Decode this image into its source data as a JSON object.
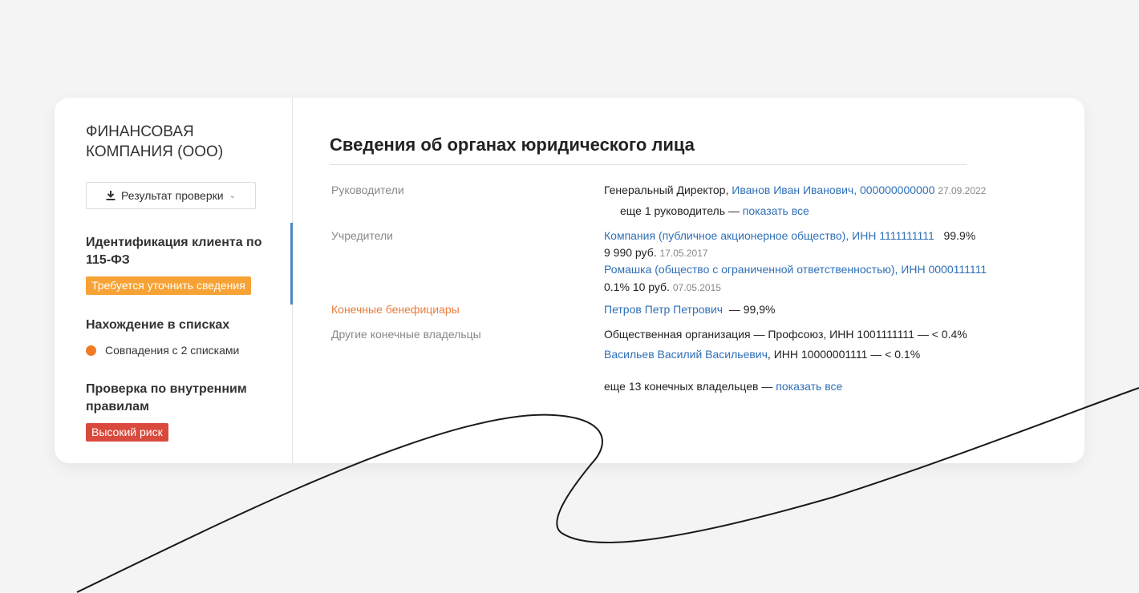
{
  "company": {
    "name": "ФИНАНСОВАЯ КОМПАНИЯ (ООО)"
  },
  "result_button": {
    "label": "Результат проверки"
  },
  "sidebar": {
    "identification": {
      "title": "Идентификация клиента по 115-ФЗ",
      "badge": "Требуется уточнить сведения"
    },
    "lists": {
      "title": "Нахождение в списках",
      "match": "Совпадения с 2 списками"
    },
    "internal": {
      "title": "Проверка по внутренним правилам",
      "badge": "Высокий риск"
    }
  },
  "main": {
    "title": "Сведения об органах юридического лица",
    "leaders": {
      "label": "Руководители",
      "position": "Генеральный Директор,",
      "person": "Иванов Иван Иванович, 000000000000",
      "date": "27.09.2022",
      "more_text": "еще 1 руководитель —",
      "more_link": "показать все"
    },
    "founders": {
      "label": "Учредители",
      "items": [
        {
          "name": "Компания (публичное акционерное общество), ИНН 1111111111",
          "share": "99.9%",
          "amount": "9 990 руб.",
          "date": "17.05.2017"
        },
        {
          "name": "Ромашка (общество с ограниченной ответственностью), ИНН 0000111111",
          "share": "0.1%",
          "amount": "10 руб.",
          "date": "07.05.2015"
        }
      ]
    },
    "beneficiaries": {
      "label": "Конечные бенефициары",
      "person": "Петров Петр Петрович",
      "share": "— 99,9%"
    },
    "other_owners": {
      "label": "Другие конечные владельцы",
      "org": "Общественная организация — Профсоюз, ИНН 1001111111 — < 0.4%",
      "person": "Васильев Василий Васильевич",
      "person_rest": ", ИНН 10000001111 — < 0.1%",
      "more_text": "еще 13 конечных владельцев —",
      "more_link": "показать все"
    }
  },
  "colors": {
    "link": "#2f6fb7",
    "accent": "#ea7b3c",
    "badge_warning": "#f6a234",
    "badge_danger": "#d94a3d",
    "active_bar": "#4f86c6"
  },
  "icons": {
    "download": "download-icon",
    "chevron": "chevron-down-icon",
    "status": "status-dot-icon"
  }
}
